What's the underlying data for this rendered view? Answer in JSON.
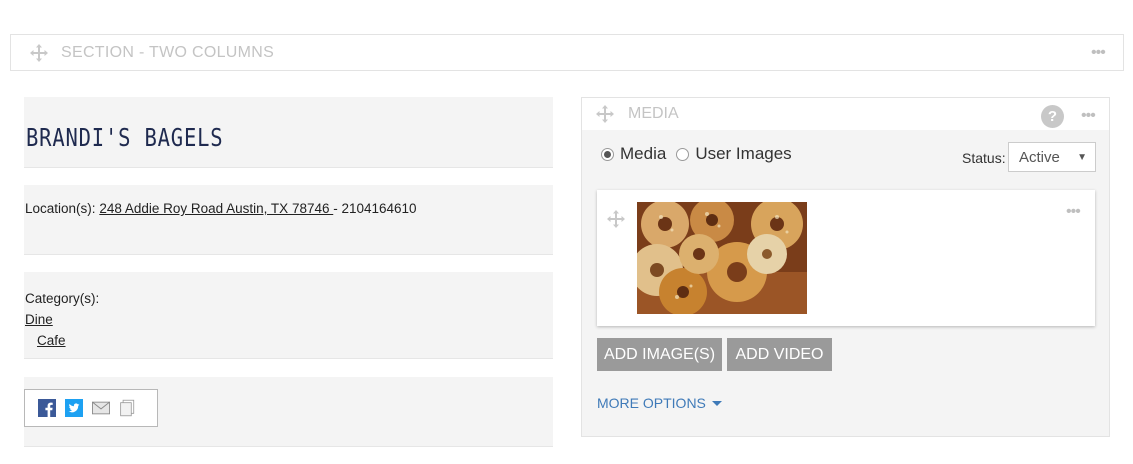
{
  "section": {
    "title": "SECTION - TWO COLUMNS",
    "menu_icon": "more-dots-icon",
    "move_icon": "move-icon"
  },
  "business": {
    "name": "BRANDI'S BAGELS",
    "location_label": "Location(s):",
    "address": "248 Addie Roy Road Austin, TX 78746 ",
    "phone_sep": "- 2104164610",
    "category_label": "Category(s):",
    "category": "Dine",
    "subcategory": "Cafe",
    "social": [
      "facebook-icon",
      "twitter-icon",
      "mail-icon",
      "copy-icon"
    ]
  },
  "media": {
    "title": "MEDIA",
    "help": "?",
    "radio_media": "Media",
    "radio_user_images": "User Images",
    "selected_radio": "Media",
    "status_label": "Status:",
    "status_value": "Active",
    "add_images": "ADD IMAGE(S)",
    "add_video": "ADD VIDEO",
    "more_options": "MORE OPTIONS"
  },
  "colors": {
    "accent": "#3f7ab8",
    "name": "#1f2a4f",
    "button": "#9a9a9a",
    "facebook": "#3b5998",
    "twitter": "#1da1f2"
  }
}
